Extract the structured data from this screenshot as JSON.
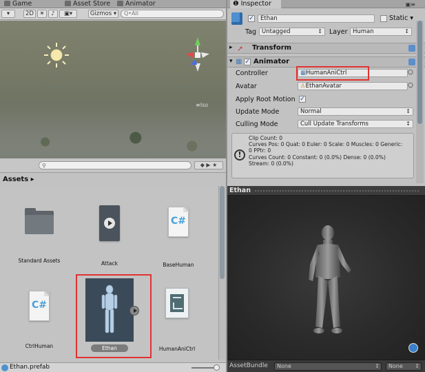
{
  "tabs": {
    "game": "Game",
    "asset_store": "Asset Store",
    "animator": "Animator"
  },
  "scene_toolbar": {
    "mode_2d": "2D",
    "gizmos": "Gizmos",
    "search_placeholder": "Q•All",
    "persp": "≡Iso"
  },
  "project": {
    "breadcrumb": "Assets",
    "items": [
      {
        "label": "Standard Assets",
        "icon": "folder-icon"
      },
      {
        "label": "Attack",
        "icon": "animation-clip-icon"
      },
      {
        "label": "BaseHuman",
        "icon": "csharp-script-icon"
      },
      {
        "label": "CtrlHuman",
        "icon": "csharp-script-icon"
      },
      {
        "label": "Ethan",
        "icon": "model-prefab-icon"
      },
      {
        "label": "HumanAniCtrl",
        "icon": "animator-controller-icon"
      }
    ],
    "selected_item": "Ethan",
    "csharp_glyph": "C#",
    "status_file": "Ethan.prefab"
  },
  "inspector": {
    "tab": "Inspector",
    "object_name": "Ethan",
    "static_label": "Static",
    "tag_label": "Tag",
    "tag_value": "Untagged",
    "layer_label": "Layer",
    "layer_value": "Human",
    "transform_label": "Transform",
    "animator_label": "Animator",
    "controller_label": "Controller",
    "controller_value": "HumanAniCtrl",
    "avatar_label": "Avatar",
    "avatar_value": "EthanAvatar",
    "apply_root_motion_label": "Apply Root Motion",
    "update_mode_label": "Update Mode",
    "update_mode_value": "Normal",
    "culling_mode_label": "Culling Mode",
    "culling_mode_value": "Cull Update Transforms",
    "info_lines": [
      "Clip Count: 0",
      "Curves Pos: 0 Quat: 0 Euler: 0 Scale: 0 Muscles: 0 Generic:",
      "0 PPtr: 0",
      "Curves Count: 0 Constant: 0 (0.0%) Dense: 0 (0.0%)",
      "Stream: 0 (0.0%)"
    ]
  },
  "preview": {
    "title": "Ethan",
    "assetbundle_label": "AssetBundle",
    "bundle_value": "None",
    "variant_value": "None"
  },
  "colors": {
    "highlight": "#e23131",
    "preview_bg": "#2c2c2c",
    "accent": "#4f92d0"
  }
}
